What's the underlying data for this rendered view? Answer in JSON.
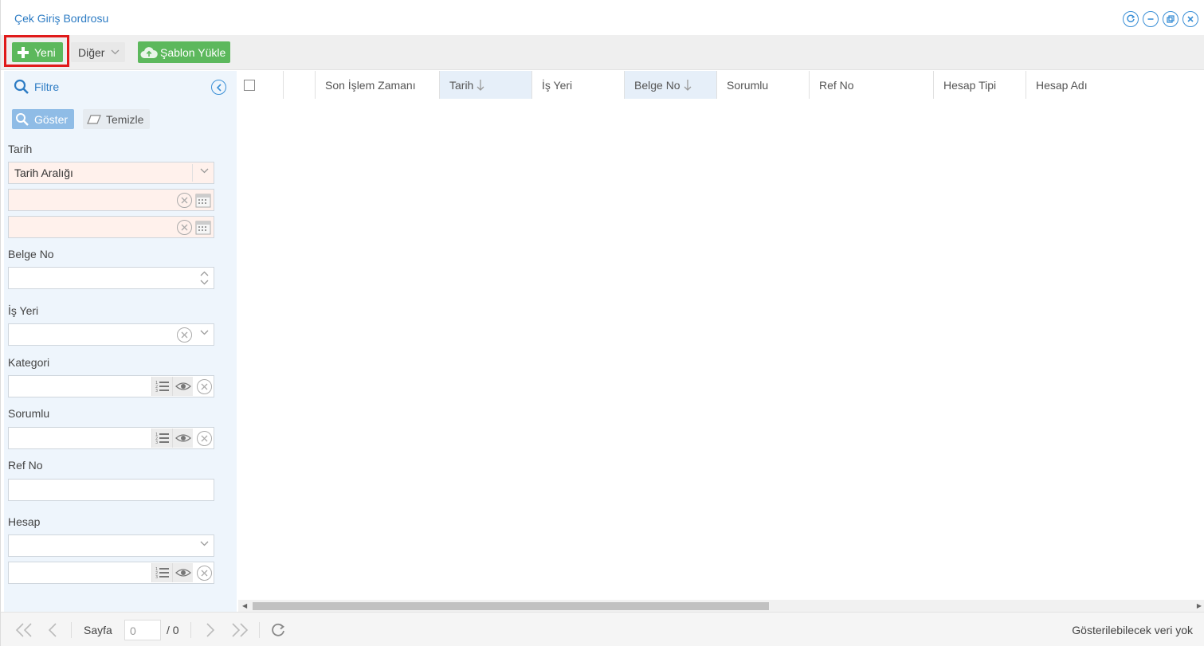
{
  "window": {
    "title": "Çek Giriş Bordrosu"
  },
  "toolbar": {
    "new_label": "Yeni",
    "other_label": "Diğer",
    "template_label": "Şablon Yükle"
  },
  "filter": {
    "title": "Filtre",
    "show_label": "Göster",
    "clear_label": "Temizle",
    "fields": {
      "date_label": "Tarih",
      "date_range_value": "Tarih Aralığı",
      "date_start_value": "",
      "date_end_value": "",
      "doc_no_label": "Belge No",
      "doc_no_value": "",
      "workplace_label": "İş Yeri",
      "workplace_value": "",
      "category_label": "Kategori",
      "category_value": "",
      "responsible_label": "Sorumlu",
      "responsible_value": "",
      "ref_no_label": "Ref No",
      "ref_no_value": "",
      "account_label": "Hesap",
      "account_type_value": "",
      "account_value": ""
    }
  },
  "grid": {
    "columns": [
      "Son İşlem Zamanı",
      "Tarih",
      "İş Yeri",
      "Belge No",
      "Sorumlu",
      "Ref No",
      "Hesap Tipi",
      "Hesap Adı"
    ],
    "rows": []
  },
  "pager": {
    "page_label": "Sayfa",
    "page_value": "0",
    "total": "/ 0",
    "status": "Gösterilebilecek veri yok"
  },
  "colors": {
    "accent": "#2d7cc4",
    "success": "#5cb85c",
    "highlight": "#e01a1a",
    "filter_bg": "#eef5fc"
  }
}
